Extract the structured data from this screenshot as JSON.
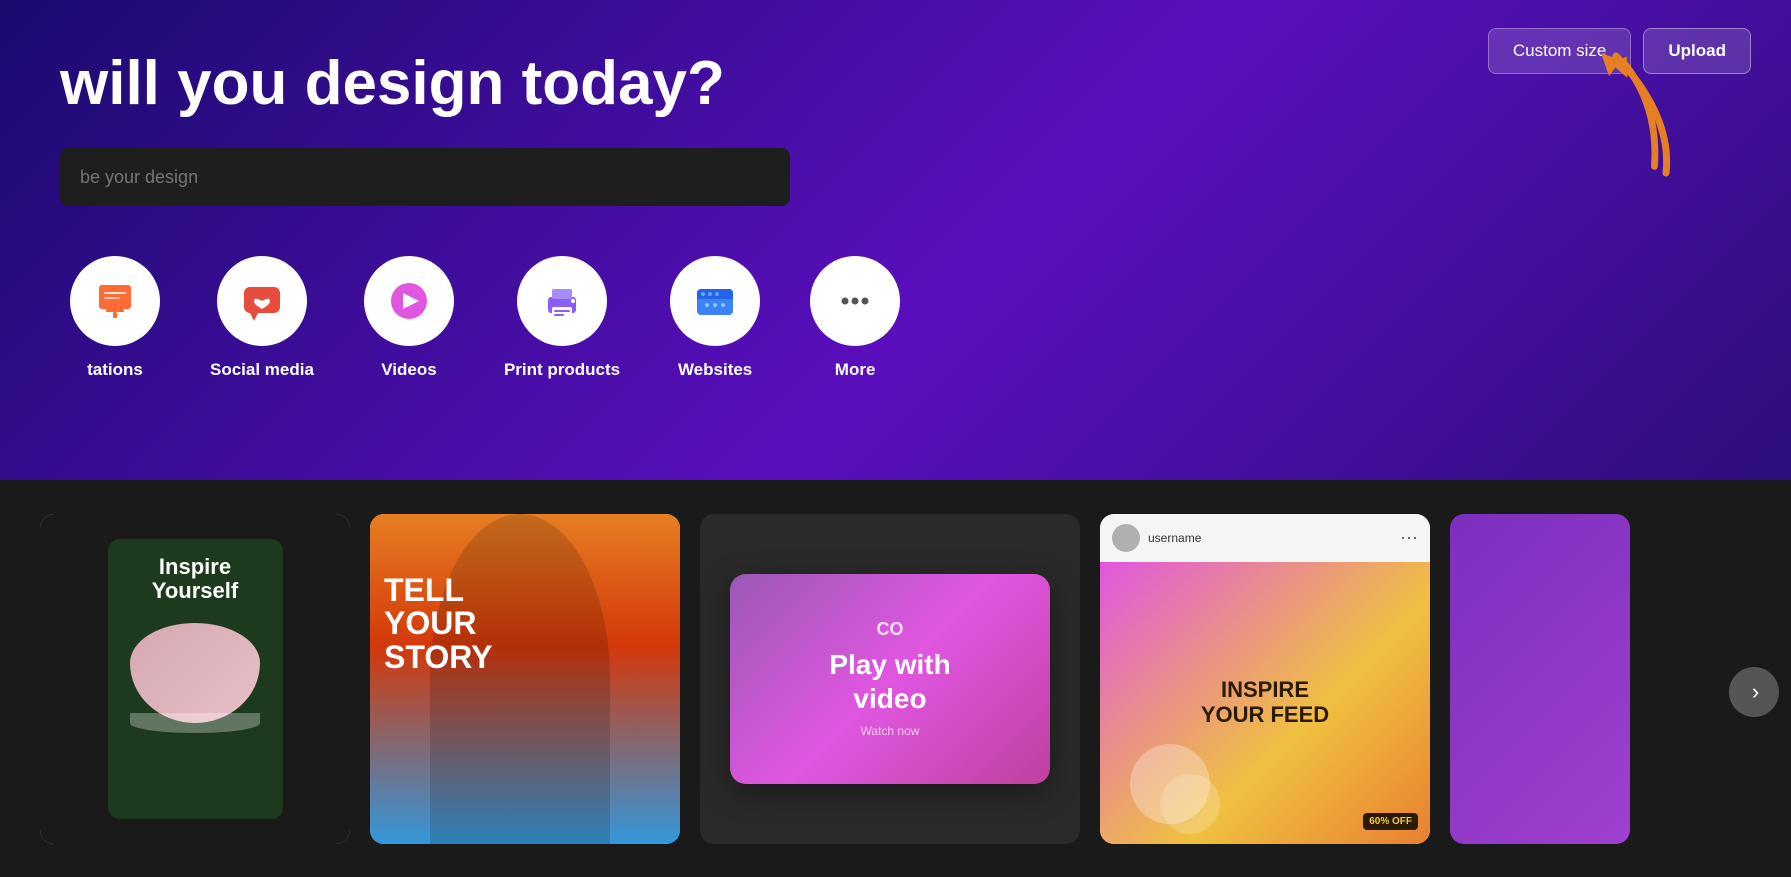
{
  "hero": {
    "title": "will you design today?",
    "search_placeholder": "be your design"
  },
  "buttons": {
    "custom_size": "Custom size",
    "upload": "Upload"
  },
  "categories": [
    {
      "id": "presentations",
      "label": "tations",
      "icon": "presentation-icon",
      "color": "#ff6b35"
    },
    {
      "id": "social-media",
      "label": "Social media",
      "icon": "heart-icon",
      "color": "#e74c3c"
    },
    {
      "id": "videos",
      "label": "Videos",
      "icon": "video-icon",
      "color": "#e056e0"
    },
    {
      "id": "print-products",
      "label": "Print products",
      "icon": "print-icon",
      "color": "#8b5cf6"
    },
    {
      "id": "websites",
      "label": "Websites",
      "icon": "website-icon",
      "color": "#3b82f6"
    },
    {
      "id": "more",
      "label": "More",
      "icon": "more-icon",
      "color": "#6b7280"
    }
  ],
  "templates": [
    {
      "id": "inspire-yourself",
      "text1": "Inspire",
      "text2": "Yourself"
    },
    {
      "id": "tell-your-story",
      "text1": "TELL",
      "text2": "YOUR",
      "text3": "STORY"
    },
    {
      "id": "play-with-video",
      "logo": "CO",
      "text1": "Play with",
      "text2": "video",
      "sub": "Watch now"
    },
    {
      "id": "inspire-your-feed",
      "text1": "INSPIRE",
      "text2": "YOUR FEED",
      "badge": "60% OFF"
    }
  ],
  "next_button_label": "›"
}
